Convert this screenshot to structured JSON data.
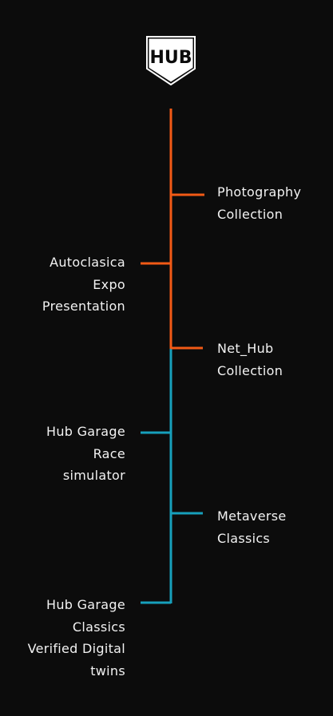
{
  "brand": {
    "logo_text": "HUB"
  },
  "colors": {
    "background": "#0c0c0c",
    "accent_orange": "#f25a16",
    "accent_teal": "#17a0bc",
    "text": "#f2f2f2"
  },
  "timeline": {
    "items": [
      {
        "text": "Photography\nCollection",
        "side": "right",
        "color": "orange"
      },
      {
        "text": "Autoclasica\nExpo\nPresentation",
        "side": "left",
        "color": "orange"
      },
      {
        "text": "Net_Hub\nCollection",
        "side": "right",
        "color": "orange"
      },
      {
        "text": "Hub Garage\nRace\nsimulator",
        "side": "left",
        "color": "teal"
      },
      {
        "text": "Metaverse\nClassics",
        "side": "right",
        "color": "teal"
      },
      {
        "text": "Hub Garage\nClassics\nVerified Digital\ntwins",
        "side": "left",
        "color": "teal"
      }
    ]
  }
}
